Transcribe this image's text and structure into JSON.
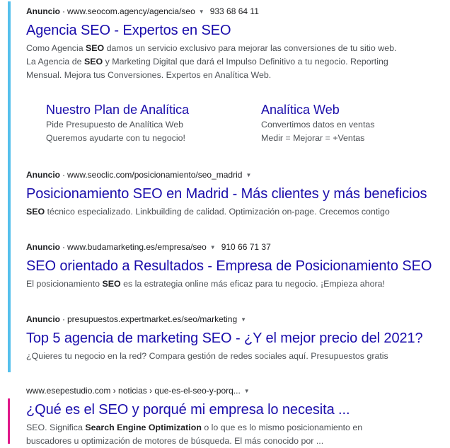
{
  "colors": {
    "link": "#1a0dab",
    "ad_bar": "#55c0ec",
    "organic_bar": "#e0198a",
    "text": "#4d5156"
  },
  "ads": [
    {
      "label": "Anuncio",
      "url": "www.seocom.agency/agencia/seo",
      "phone": "933 68 64 11",
      "title_a": "Agencia SEO",
      "title_b": "Expertos en SEO",
      "desc_lines": [
        {
          "pre": "Como Agencia ",
          "bold": "SEO",
          "post": " damos un servicio exclusivo para mejorar las conversiones de tu sitio web."
        },
        {
          "pre": "La Agencia de ",
          "bold": "SEO",
          "post": " y Marketing Digital que dará el Impulso Definitivo a tu negocio. Reporting"
        },
        {
          "pre": "Mensual. Mejora tus Conversiones. Expertos en Analítica Web.",
          "bold": "",
          "post": ""
        }
      ],
      "sitelinks": [
        {
          "title": "Nuestro Plan de Analítica",
          "line1": "Pide Presupuesto de Analítica Web",
          "line2": "Queremos ayudarte con tu negocio!"
        },
        {
          "title": "Analítica Web",
          "line1": "Convertimos datos en ventas",
          "line2": "Medir = Mejorar = +Ventas"
        }
      ]
    },
    {
      "label": "Anuncio",
      "url": "www.seoclic.com/posicionamiento/seo_madrid",
      "title_a": "Posicionamiento SEO en Madrid",
      "title_b": "Más clientes y más beneficios",
      "desc_bold": "SEO",
      "desc_post": " técnico especializado. Linkbuilding de calidad. Optimización on-page. Crecemos contigo"
    },
    {
      "label": "Anuncio",
      "url": "www.budamarketing.es/empresa/seo",
      "phone": "910 66 71 37",
      "title_a": "SEO orientado a Resultados",
      "title_b": "Empresa de Posicionamiento SEO",
      "desc_pre": "El posicionamiento ",
      "desc_bold": "SEO",
      "desc_post": " es la estrategia online más eficaz para tu negocio. ¡Empieza ahora!"
    },
    {
      "label": "Anuncio",
      "url": "presupuestos.expertmarket.es/seo/marketing",
      "title_a": "Top 5 agencia de marketing SEO",
      "title_b": "¿Y el mejor precio del 2021?",
      "desc": "¿Quieres tu negocio en la red? Compara gestión de redes sociales aquí. Presupuestos gratis"
    }
  ],
  "organic": {
    "url": "www.esepestudio.com › noticias › que-es-el-seo-y-porq...",
    "title": "¿Qué es el SEO y porqué mi empresa lo necesita ...",
    "line1_pre": "SEO. Significa ",
    "line1_bold": "Search Engine Optimization",
    "line1_post": " o lo que es lo mismo posicionamiento en",
    "line2": "buscadores u optimización de motores de búsqueda. El más conocido por ..."
  },
  "separator": "·",
  "title_separator": " - ",
  "caret": "▼"
}
